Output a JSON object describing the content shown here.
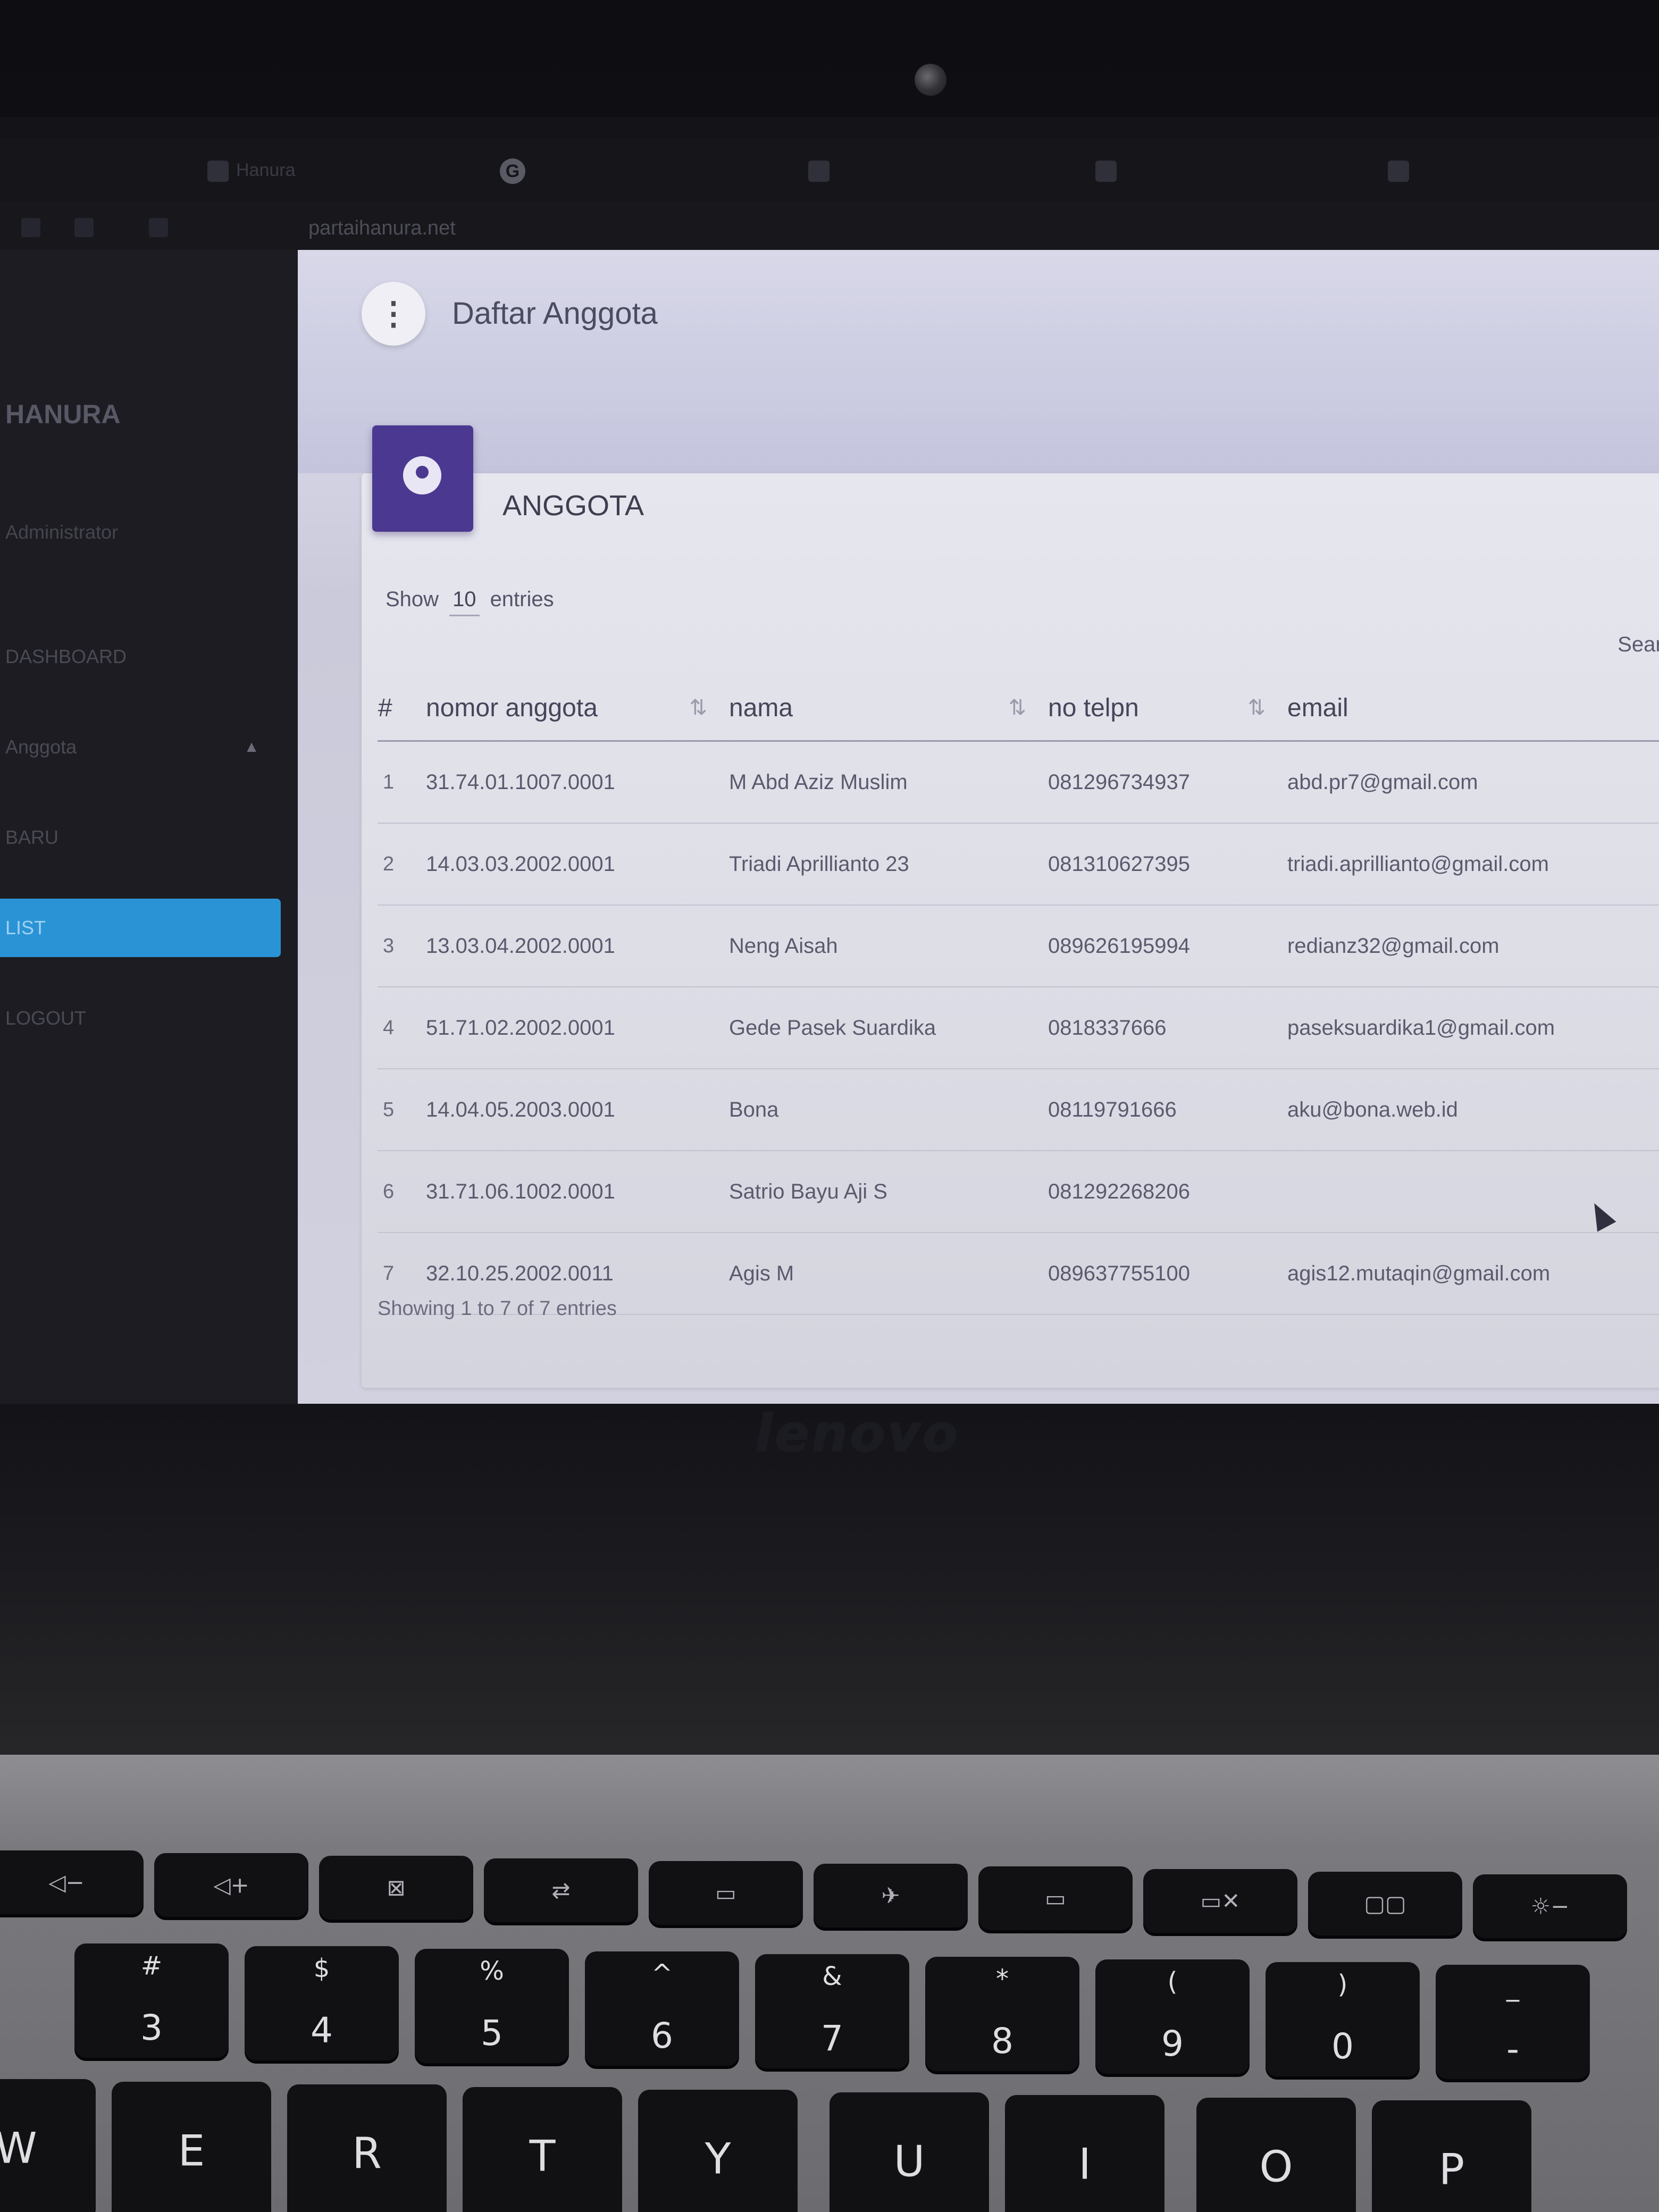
{
  "browser": {
    "tabs": [
      {
        "label": "Hanura",
        "icon": "page-icon"
      },
      {
        "label": "",
        "icon": "google-icon",
        "glyph": "G"
      },
      {
        "label": "",
        "icon": "page-icon"
      },
      {
        "label": "",
        "icon": "page-icon"
      },
      {
        "label": "",
        "icon": "page-icon"
      }
    ],
    "url": "partaihanura.net"
  },
  "sidebar": {
    "brand": "HANURA",
    "user": "Administrator",
    "items": [
      {
        "label": "DASHBOARD",
        "active": false
      },
      {
        "label": "Anggota",
        "active": false,
        "caret": "▲"
      },
      {
        "label": "BARU",
        "active": false
      },
      {
        "label": "LIST",
        "active": true
      },
      {
        "label": "LOGOUT",
        "active": false
      }
    ]
  },
  "header": {
    "menu_icon": "more-vertical-icon",
    "menu_glyph": "⋮",
    "title": "Daftar Anggota"
  },
  "card": {
    "icon": "person-icon",
    "title": "ANGGOTA",
    "show_label": "Show",
    "show_value": "10",
    "entries_label": "entries",
    "search_label": "Search:"
  },
  "table": {
    "sort_glyph": "⇅",
    "columns": [
      "#",
      "nomor anggota",
      "nama",
      "no telpn",
      "email"
    ],
    "rows": [
      {
        "no": "1",
        "nomor": "31.74.01.1007.0001",
        "nama": "M Abd Aziz Muslim",
        "telpn": "081296734937",
        "email": "abd.pr7@gmail.com"
      },
      {
        "no": "2",
        "nomor": "14.03.03.2002.0001",
        "nama": "Triadi Aprillianto 23",
        "telpn": "081310627395",
        "email": "triadi.aprillianto@gmail.com"
      },
      {
        "no": "3",
        "nomor": "13.03.04.2002.0001",
        "nama": "Neng Aisah",
        "telpn": "089626195994",
        "email": "redianz32@gmail.com"
      },
      {
        "no": "4",
        "nomor": "51.71.02.2002.0001",
        "nama": "Gede Pasek Suardika",
        "telpn": "0818337666",
        "email": "paseksuardika1@gmail.com"
      },
      {
        "no": "5",
        "nomor": "14.04.05.2003.0001",
        "nama": "Bona",
        "telpn": "08119791666",
        "email": "aku@bona.web.id"
      },
      {
        "no": "6",
        "nomor": "31.71.06.1002.0001",
        "nama": "Satrio Bayu Aji S",
        "telpn": "081292268206",
        "email": ""
      },
      {
        "no": "7",
        "nomor": "32.10.25.2002.0011",
        "nama": "Agis M",
        "telpn": "089637755100",
        "email": "agis12.mutaqin@gmail.com"
      }
    ],
    "info": "Showing 1 to 7 of 7 entries"
  },
  "laptop": {
    "brand": "lenovo"
  },
  "keyboard": {
    "fn_row": [
      "◁−",
      "◁+",
      "⊠",
      "⇄",
      "▭",
      "✈",
      "▭",
      "▭✕",
      "▢▢",
      "☼−"
    ],
    "number_row": [
      {
        "top": "#",
        "bottom": "3"
      },
      {
        "top": "$",
        "bottom": "4"
      },
      {
        "top": "%",
        "bottom": "5"
      },
      {
        "top": "^",
        "bottom": "6"
      },
      {
        "top": "&",
        "bottom": "7"
      },
      {
        "top": "*",
        "bottom": "8"
      },
      {
        "top": "(",
        "bottom": "9"
      },
      {
        "top": ")",
        "bottom": "0"
      },
      {
        "top": "_",
        "bottom": "-"
      }
    ],
    "letter_row": [
      "W",
      "E",
      "R",
      "T",
      "Y",
      "U",
      "I",
      "O",
      "P"
    ]
  }
}
